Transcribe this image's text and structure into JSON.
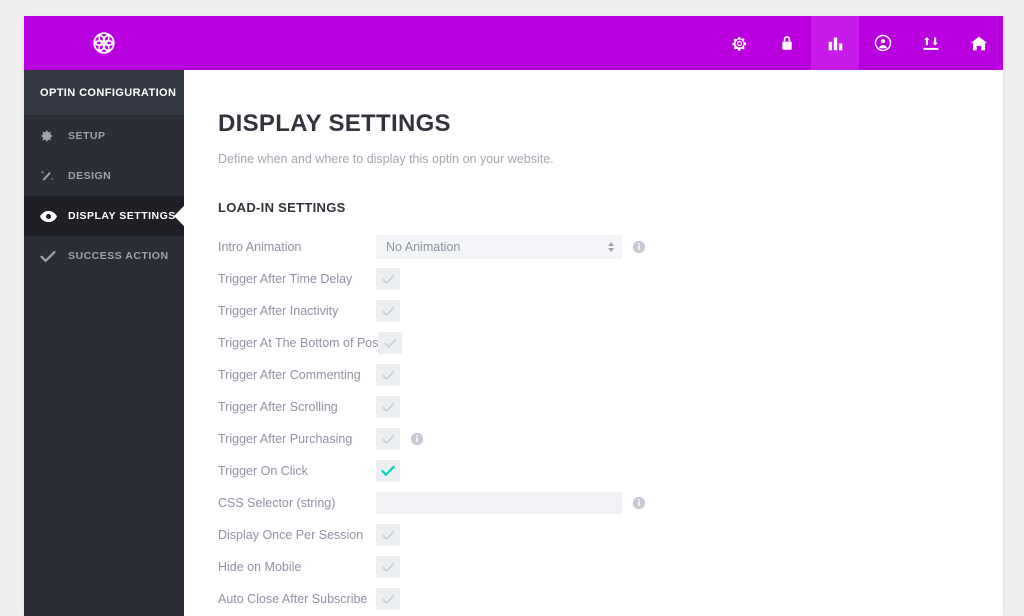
{
  "topbar": {
    "logo_name": "bloom-logo",
    "accent_color": "#b900de",
    "accent_active_color": "#c81ae8",
    "nav_items": [
      {
        "icon": "gear-icon",
        "name": "settings",
        "active": false
      },
      {
        "icon": "lock-icon",
        "name": "license",
        "active": false
      },
      {
        "icon": "bar-chart-icon",
        "name": "statistics",
        "active": true
      },
      {
        "icon": "user-circle-icon",
        "name": "account",
        "active": false
      },
      {
        "icon": "import-export-icon",
        "name": "import-export",
        "active": false
      },
      {
        "icon": "home-icon",
        "name": "home",
        "active": false
      }
    ]
  },
  "sidebar": {
    "title": "OPTIN CONFIGURATION",
    "items": [
      {
        "label": "SETUP",
        "icon": "gear-icon",
        "active": false
      },
      {
        "label": "DESIGN",
        "icon": "magic-wand-icon",
        "active": false
      },
      {
        "label": "DISPLAY SETTINGS",
        "icon": "eye-icon",
        "active": true
      },
      {
        "label": "SUCCESS ACTION",
        "icon": "check-icon",
        "active": false
      }
    ]
  },
  "main": {
    "title": "DISPLAY SETTINGS",
    "subtitle": "Define when and where to display this optin on your website.",
    "section_title": "LOAD-IN SETTINGS",
    "checked_color": "#00d4c4",
    "rows": [
      {
        "label": "Intro Animation",
        "control": "select",
        "value": "No Animation",
        "info": true
      },
      {
        "label": "Trigger After Time Delay",
        "control": "checkbox",
        "checked": false,
        "info": false
      },
      {
        "label": "Trigger After Inactivity",
        "control": "checkbox",
        "checked": false,
        "info": false
      },
      {
        "label": "Trigger At The Bottom of Post",
        "control": "checkbox",
        "checked": false,
        "info": false,
        "wide": true
      },
      {
        "label": "Trigger After Commenting",
        "control": "checkbox",
        "checked": false,
        "info": false
      },
      {
        "label": "Trigger After Scrolling",
        "control": "checkbox",
        "checked": false,
        "info": false
      },
      {
        "label": "Trigger After Purchasing",
        "control": "checkbox",
        "checked": false,
        "info": true
      },
      {
        "label": "Trigger On Click",
        "control": "checkbox",
        "checked": true,
        "info": false
      },
      {
        "label": "CSS Selector (string)",
        "control": "text",
        "value": "",
        "placeholder": "",
        "info": true
      },
      {
        "label": "Display Once Per Session",
        "control": "checkbox",
        "checked": false,
        "info": false
      },
      {
        "label": "Hide on Mobile",
        "control": "checkbox",
        "checked": false,
        "info": false
      },
      {
        "label": "Auto Close After Subscribe",
        "control": "checkbox",
        "checked": false,
        "info": false
      }
    ]
  }
}
